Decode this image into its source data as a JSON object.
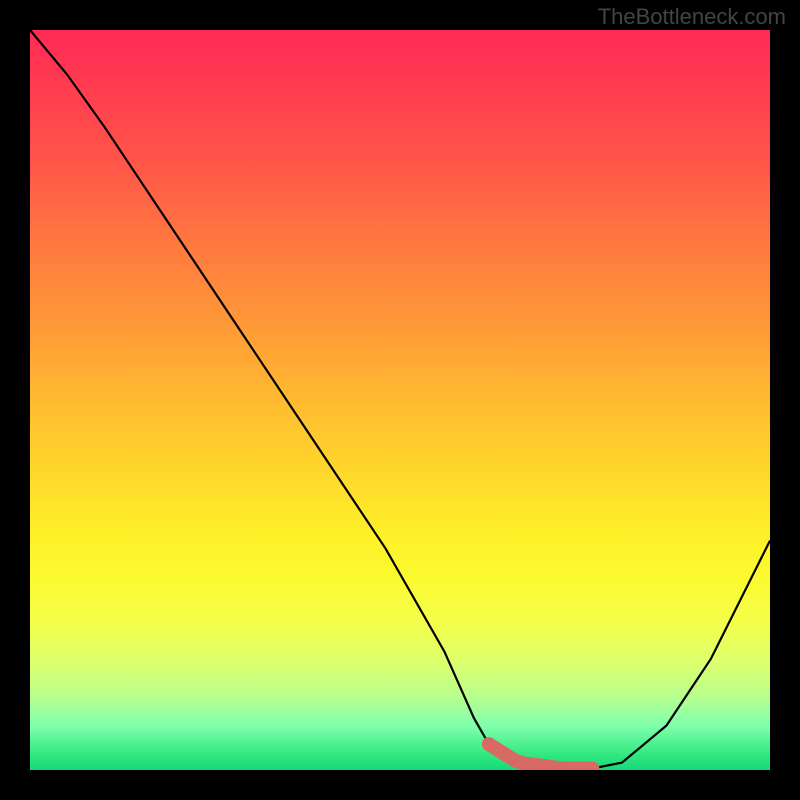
{
  "watermark": "TheBottleneck.com",
  "chart_data": {
    "type": "line",
    "title": "",
    "xlabel": "",
    "ylabel": "",
    "xlim": [
      0,
      100
    ],
    "ylim": [
      0,
      100
    ],
    "grid": false,
    "series": [
      {
        "name": "bottleneck-curve",
        "x": [
          0,
          5,
          10,
          18,
          28,
          38,
          48,
          56,
          60,
          62,
          66,
          72,
          76,
          80,
          86,
          92,
          100
        ],
        "y": [
          100,
          94,
          87,
          75,
          60,
          45,
          30,
          16,
          7,
          3.5,
          1,
          0.2,
          0.2,
          1,
          6,
          15,
          31
        ],
        "stroke": "#000000",
        "stroke_width": 2
      }
    ],
    "highlight_region": {
      "x_start": 62,
      "x_end": 76,
      "color": "#d86a64",
      "description": "optimal-range-marker"
    },
    "background_gradient": {
      "direction": "vertical",
      "stops": [
        {
          "pos": 0,
          "color": "#ff2a55"
        },
        {
          "pos": 50,
          "color": "#ffc030"
        },
        {
          "pos": 78,
          "color": "#fef526"
        },
        {
          "pos": 100,
          "color": "#18d878"
        }
      ]
    }
  }
}
